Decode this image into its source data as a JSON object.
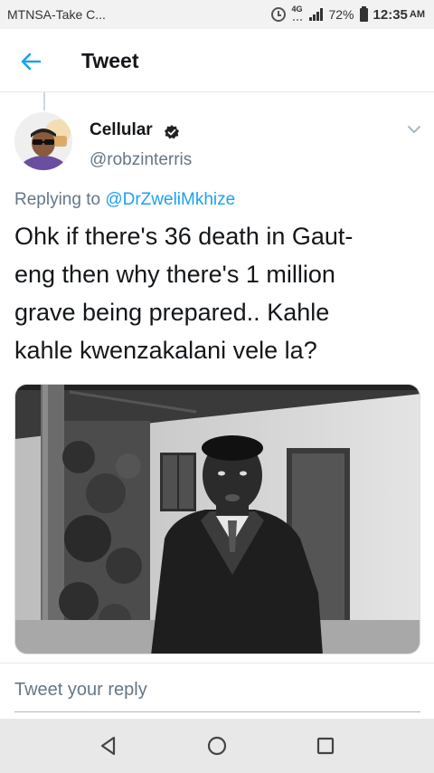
{
  "status_bar": {
    "carrier": "MTNSA-Take C...",
    "network": "4G",
    "battery": "72%",
    "time": "12:35",
    "ampm": "AM"
  },
  "header": {
    "title": "Tweet",
    "back_icon": "arrow-left-icon",
    "accent": "#1da1f2"
  },
  "tweet": {
    "display_name": "Cellular",
    "verified_icon": "badge-icon",
    "handle": "@robzinterris",
    "replying_prefix": "Replying to",
    "replying_to": "@DrZweliMkhize",
    "text_lines": [
      "Ohk if there's 36 death in Gaut-",
      "eng then why there's 1 million",
      "grave being prepared.. Kahle",
      "kahle kwenzakalani vele la?"
    ]
  },
  "reply": {
    "placeholder": "Tweet your reply"
  },
  "nav": {
    "back_icon": "triangle-back-icon",
    "home_icon": "circle-home-icon",
    "recents_icon": "square-recents-icon"
  }
}
